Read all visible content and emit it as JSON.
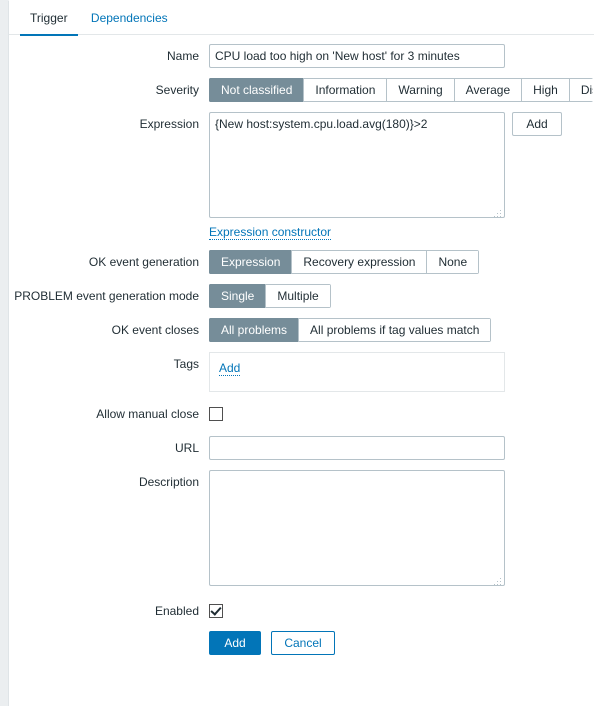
{
  "tabs": [
    {
      "label": "Trigger",
      "active": true
    },
    {
      "label": "Dependencies",
      "active": false
    }
  ],
  "form": {
    "name": {
      "label": "Name",
      "value": "CPU load too high on 'New host' for 3 minutes",
      "placeholder": ""
    },
    "severity": {
      "label": "Severity",
      "options": [
        "Not classified",
        "Information",
        "Warning",
        "Average",
        "High",
        "Disaster"
      ],
      "selected": "Not classified"
    },
    "expression": {
      "label": "Expression",
      "value": "{New host:system.cpu.load.avg(180)}>2",
      "add_button": "Add",
      "constructor_link": "Expression constructor"
    },
    "ok_event_generation": {
      "label": "OK event generation",
      "options": [
        "Expression",
        "Recovery expression",
        "None"
      ],
      "selected": "Expression"
    },
    "problem_event_generation_mode": {
      "label": "PROBLEM event generation mode",
      "options": [
        "Single",
        "Multiple"
      ],
      "selected": "Single"
    },
    "ok_event_closes": {
      "label": "OK event closes",
      "options": [
        "All problems",
        "All problems if tag values match"
      ],
      "selected": "All problems"
    },
    "tags": {
      "label": "Tags",
      "add_link": "Add"
    },
    "allow_manual_close": {
      "label": "Allow manual close",
      "checked": false
    },
    "url": {
      "label": "URL",
      "value": "",
      "placeholder": ""
    },
    "description": {
      "label": "Description",
      "value": "",
      "placeholder": ""
    },
    "enabled": {
      "label": "Enabled",
      "checked": true
    }
  },
  "footer": {
    "submit_label": "Add",
    "cancel_label": "Cancel"
  },
  "colors": {
    "accent": "#0275b8",
    "selected_segment": "#768d99",
    "border": "#b5c2c9",
    "page_background": "#ebeef0",
    "text": "#1f2c33"
  }
}
